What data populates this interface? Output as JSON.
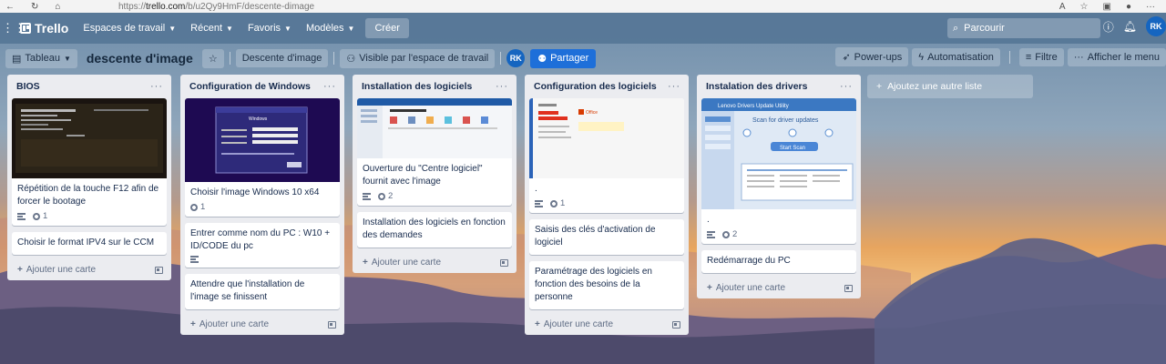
{
  "browser": {
    "url_prefix": "https://",
    "url_domain": "trello.com",
    "url_path": "/b/u2Qy9HmF/descente-dimage"
  },
  "header": {
    "logo": "Trello",
    "menu": [
      "Espaces de travail",
      "Récent",
      "Favoris",
      "Modèles"
    ],
    "create": "Créer",
    "search_placeholder": "Parcourir",
    "avatar": "RK"
  },
  "boardbar": {
    "view": "Tableau",
    "title": "descente d'image",
    "workspace": "Descente d'image",
    "visibility": "Visible par l'espace de travail",
    "member": "RK",
    "share": "Partager",
    "powerups": "Power-ups",
    "automation": "Automatisation",
    "filter": "Filtre",
    "menu": "Afficher le menu"
  },
  "lists": [
    {
      "title": "BIOS",
      "cards": [
        {
          "text": "Répétition de la touche F12 afin de forcer le bootage",
          "desc": true,
          "attachments": "1"
        },
        {
          "text": "Choisir le format IPV4 sur le CCM"
        }
      ]
    },
    {
      "title": "Configuration de Windows",
      "cards": [
        {
          "text": "Choisir l'image Windows 10 x64",
          "attachments": "1"
        },
        {
          "text": "Entrer comme nom du PC : W10 + ID/CODE du pc",
          "desc": true
        },
        {
          "text": "Attendre que l'installation de l'image se finissent"
        }
      ]
    },
    {
      "title": "Installation des logiciels",
      "cards": [
        {
          "text": "Ouverture du \"Centre logiciel\" fournit avec l'image",
          "desc": true,
          "attachments": "2"
        },
        {
          "text": "Installation des logiciels en fonction des demandes"
        }
      ]
    },
    {
      "title": "Configuration des logiciels",
      "cards": [
        {
          "text": ".",
          "desc": true,
          "attachments": "1"
        },
        {
          "text": "Saisis des clés d'activation de logiciel"
        },
        {
          "text": "Paramétrage des logiciels en fonction des besoins de la personne"
        }
      ]
    },
    {
      "title": "Instalation des drivers",
      "cards": [
        {
          "text": ".",
          "desc": true,
          "attachments": "2"
        },
        {
          "text": "Redémarrage du PC"
        }
      ]
    }
  ],
  "add_card": "Ajouter une carte",
  "add_list": "Ajoutez une autre liste",
  "screenshot_text": {
    "windows_title": "Windows",
    "lenovo_title": "Lenovo Drivers Update Utility",
    "lenovo_scan": "Scan for driver updates",
    "lenovo_button": "Start Scan",
    "office": "Office"
  }
}
